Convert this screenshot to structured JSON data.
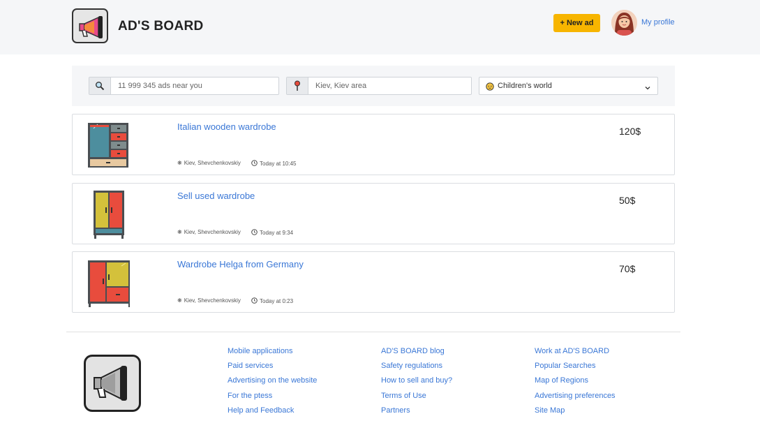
{
  "header": {
    "title": "AD'S BOARD",
    "new_ad_label": "+ New ad",
    "profile_label": "My profile"
  },
  "search": {
    "query_placeholder": "11 999 345 ads near you",
    "location_value": "Kiev, Kiev area",
    "category_value": "Children's world"
  },
  "ads": [
    {
      "title": "Italian wooden wardrobe",
      "price": "120$",
      "location": "Kiev, Shevchenkovskiy",
      "time": "Today at 10:45"
    },
    {
      "title": "Sell used wardrobe",
      "price": "50$",
      "location": "Kiev, Shevchenkovskiy",
      "time": "Today at 9:34"
    },
    {
      "title": "Wardrobe Helga from Germany",
      "price": "70$",
      "location": "Kiev, Shevchenkovskiy",
      "time": "Today at 0:23"
    }
  ],
  "footer": {
    "col1": [
      "Mobile applications",
      "Paid services",
      "Advertising on the website",
      "For the ptess",
      "Help and Feedback"
    ],
    "col2": [
      "AD'S BOARD blog",
      "Safety regulations",
      "How to sell and buy?",
      "Terms of Use",
      "Partners"
    ],
    "col3": [
      "Work at AD'S BOARD",
      "Popular Searches",
      "Map of Regions",
      "Advertising preferences",
      "Site Map"
    ]
  },
  "colors": {
    "accent_link": "#3a77d6",
    "button_yellow": "#f7b500",
    "panel_bg": "#f5f6f8"
  },
  "icons": [
    "megaphone-logo-icon",
    "search-icon",
    "location-pin-icon",
    "child-face-icon",
    "chevron-down-icon",
    "clock-icon",
    "location-dot-icon",
    "wardrobe-icon"
  ]
}
